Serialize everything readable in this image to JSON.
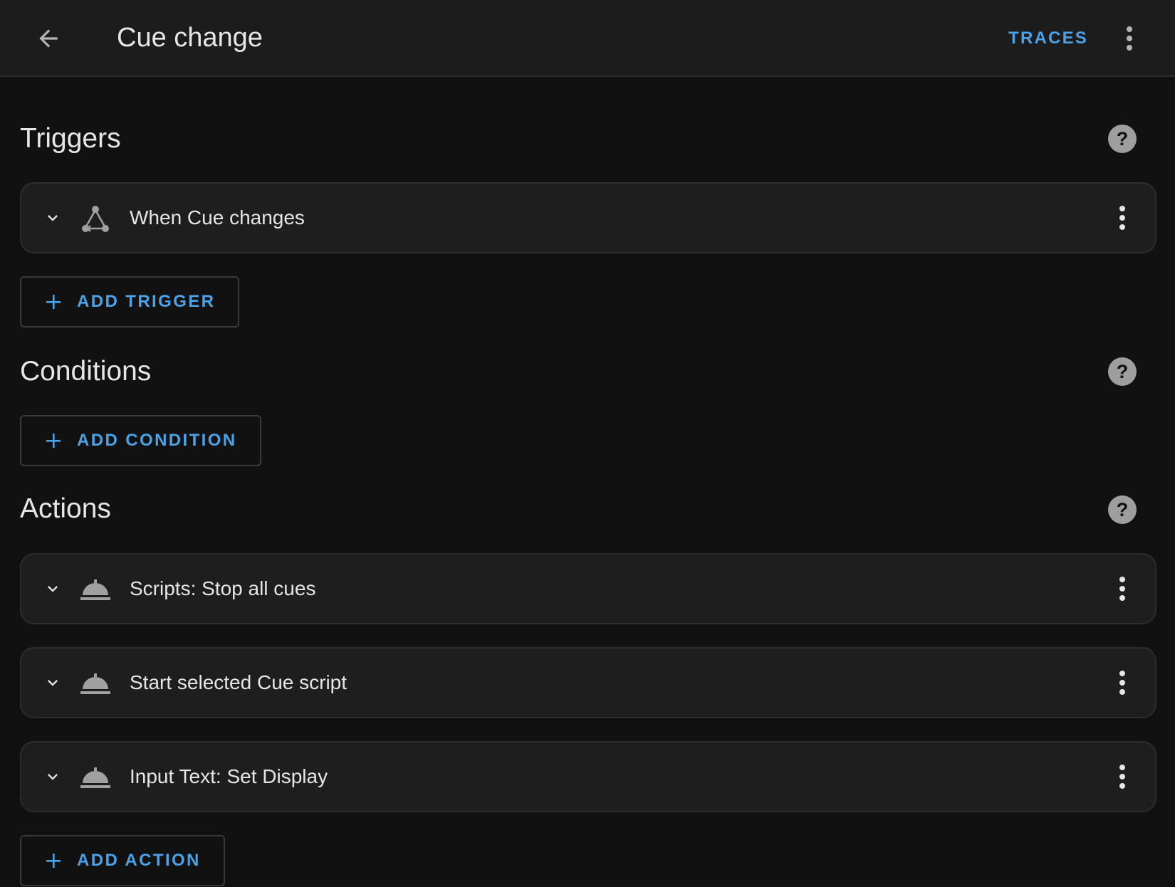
{
  "header": {
    "title": "Cue change",
    "traces_label": "TRACES",
    "back_icon": "arrow-left-icon",
    "menu_icon": "dots-vertical-icon"
  },
  "colors": {
    "background": "#111111",
    "header_bg": "#1c1c1c",
    "card_bg": "#1e1e1e",
    "accent": "#4aa3e8",
    "text": "#e6e6e6",
    "icon_gray": "#a0a0a0"
  },
  "triggers": {
    "title": "Triggers",
    "items": [
      {
        "label": "When Cue changes",
        "icon": "state-change-icon"
      }
    ],
    "add_label": "ADD TRIGGER"
  },
  "conditions": {
    "title": "Conditions",
    "add_label": "ADD CONDITION"
  },
  "actions": {
    "title": "Actions",
    "items": [
      {
        "label": "Scripts: Stop all cues",
        "icon": "service-bell-icon"
      },
      {
        "label": "Start selected Cue script",
        "icon": "service-bell-icon"
      },
      {
        "label": "Input Text: Set Display",
        "icon": "service-bell-icon"
      }
    ],
    "add_label": "ADD ACTION"
  }
}
